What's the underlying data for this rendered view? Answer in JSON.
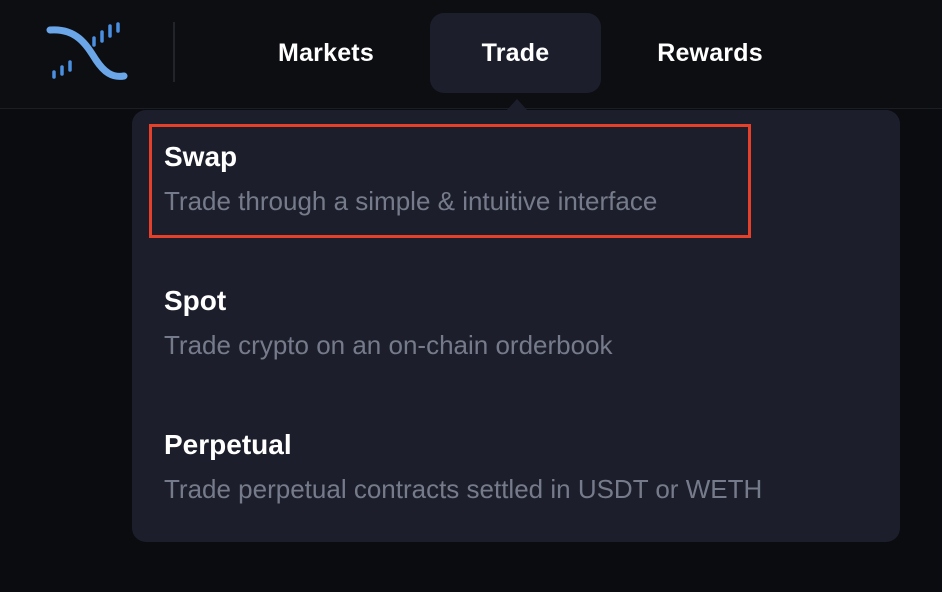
{
  "nav": {
    "items": [
      {
        "label": "Markets"
      },
      {
        "label": "Trade",
        "active": true
      },
      {
        "label": "Rewards"
      }
    ]
  },
  "logo": {
    "icon": "brand-logo-icon",
    "colors": {
      "curve": "#6aa6e8",
      "bars": "#4b8fe0"
    }
  },
  "dropdown": {
    "items": [
      {
        "title": "Swap",
        "description": "Trade through a simple & intuitive interface",
        "highlighted": true
      },
      {
        "title": "Spot",
        "description": "Trade crypto on an on-chain orderbook"
      },
      {
        "title": "Perpetual",
        "description": "Trade perpetual contracts settled in USDT or WETH"
      }
    ]
  },
  "colors": {
    "background": "#0b0c10",
    "panel": "#1c1f2b",
    "highlight_border": "#e5412a",
    "muted_text": "#767b8b"
  }
}
